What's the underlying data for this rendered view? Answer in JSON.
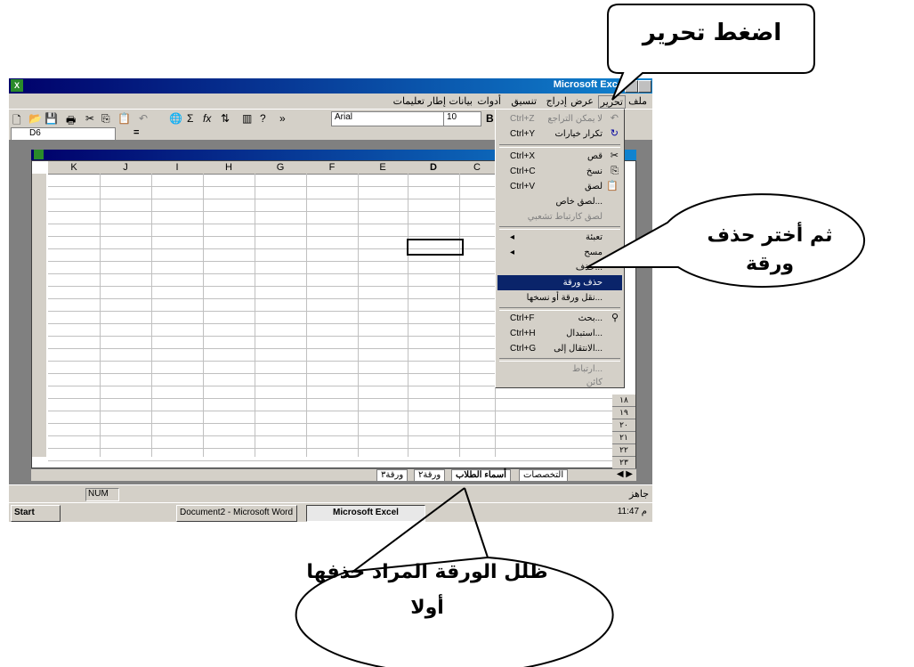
{
  "window": {
    "title": "Microsoft Excel"
  },
  "menubar": {
    "items": [
      "ملف",
      "تحرير",
      "عرض",
      "إدراج",
      "تنسيق",
      "أدوات",
      "بيانات",
      "إطار",
      "تعليمات"
    ]
  },
  "toolbar": {
    "font": "Arial",
    "size": "10",
    "bold": "B"
  },
  "formula": {
    "cell_ref": "D6",
    "equals": "="
  },
  "columns": [
    "K",
    "J",
    "I",
    "H",
    "G",
    "F",
    "E",
    "D",
    "C"
  ],
  "row_numbers": [
    "١٨",
    "١٩",
    "٢٠",
    "٢١",
    "٢٢",
    "٢٣"
  ],
  "edit_menu": {
    "undo": {
      "label": "لا يمكن التراجع",
      "shortcut": "Ctrl+Z"
    },
    "redo": {
      "label": "تكرار خيارات",
      "shortcut": "Ctrl+Y"
    },
    "cut": {
      "label": "قص",
      "shortcut": "Ctrl+X"
    },
    "copy": {
      "label": "نسخ",
      "shortcut": "Ctrl+C"
    },
    "paste": {
      "label": "لصق",
      "shortcut": "Ctrl+V"
    },
    "paste_special": {
      "label": "لصق خاص..."
    },
    "paste_hyperlink": {
      "label": "لصق كارتباط تشعبي"
    },
    "fill": {
      "label": "تعبئة"
    },
    "clear": {
      "label": "مسح"
    },
    "delete": {
      "label": "حذف..."
    },
    "delete_sheet": {
      "label": "حذف ورقة"
    },
    "move_copy": {
      "label": "نقل ورقة أو نسخها..."
    },
    "find": {
      "label": "بحث...",
      "shortcut": "Ctrl+F"
    },
    "replace": {
      "label": "استبدال...",
      "shortcut": "Ctrl+H"
    },
    "goto": {
      "label": "الانتقال إلى...",
      "shortcut": "Ctrl+G"
    },
    "links": {
      "label": "ارتباط..."
    },
    "object": {
      "label": "كائن"
    }
  },
  "sheet_tabs": [
    "ورقة٣",
    "ورقة٢",
    "أسماء الطلاب",
    "التخصصات"
  ],
  "status": {
    "ready": "جاهز",
    "num": "NUM"
  },
  "taskbar": {
    "start": "Start",
    "word": "Document2 - Microsoft Word",
    "excel": "Microsoft Excel",
    "clock": "11:47 م"
  },
  "callouts": {
    "top": "اضغط تحرير",
    "right_line1": "ثم أختر حذف",
    "right_line2": "ورقة",
    "bottom_line1": "ظلل الورقة المراد حذفها",
    "bottom_line2": "أولا"
  }
}
